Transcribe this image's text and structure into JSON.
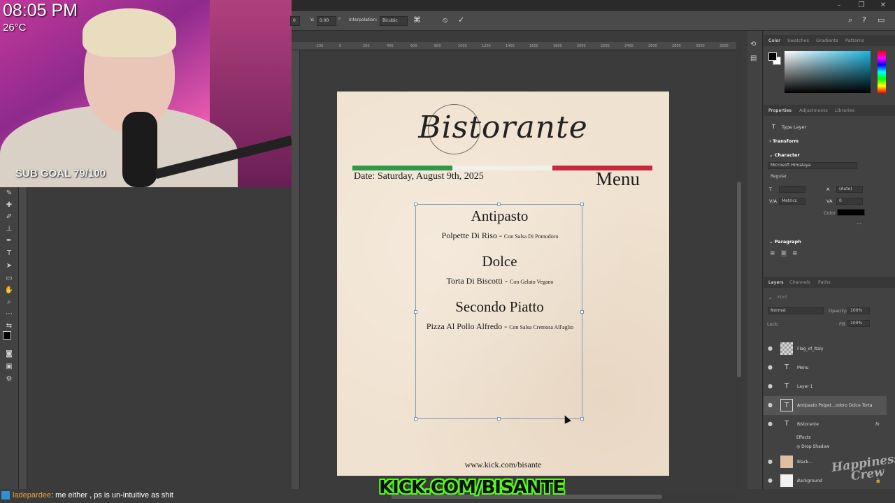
{
  "stream": {
    "clock": "08:05 PM",
    "temperature": "26°C",
    "sub_goal": "SUB GOAL 79/100",
    "kick_banner": "KICK.COM/BISANTE",
    "chat": {
      "username": "ladepardee",
      "message": ": me either , ps is un-intuitive as shit"
    },
    "watermark": "Happiness Crew"
  },
  "options_bar": {
    "v_label": "V:",
    "v_value": "0.00",
    "interpolation_label": "Interpolation:",
    "interpolation_value": "Bicubic"
  },
  "ruler_ticks": [
    "-200",
    "0",
    "200",
    "400",
    "600",
    "800",
    "1000",
    "1200",
    "1400",
    "1600",
    "1800",
    "2000",
    "2200",
    "2400",
    "2600",
    "2800",
    "3000",
    "3200"
  ],
  "document": {
    "title": "Bistorante",
    "date": "Date: Saturday, August 9th, 2025",
    "menu_label": "Menu",
    "sections": [
      {
        "heading": "Antipasto",
        "item": "Polpette Di Riso - ",
        "detail": "Con Salsa Di Pomodoro"
      },
      {
        "heading": "Dolce",
        "item": "Torta Di Biscotti - ",
        "detail": "Con Gelato Vegano"
      },
      {
        "heading": "Secondo Piatto",
        "item": "Pizza Al Pollo Alfredo - ",
        "detail": "Con Salsa Cremosa All'aglio"
      }
    ],
    "footer_url": "www.kick.com/bisante",
    "flag_colors": [
      "#2e9a46",
      "#f2f0ea",
      "#c8283c"
    ]
  },
  "color_panel": {
    "tabs": [
      "Color",
      "Swatches",
      "Gradients",
      "Patterns"
    ]
  },
  "properties_panel": {
    "tabs": [
      "Properties",
      "Adjustments",
      "Libraries"
    ],
    "layer_type": "Type Layer",
    "transform_label": "Transform",
    "character_label": "Character",
    "font_family": "Microsoft Himalaya",
    "font_style": "Regular",
    "leading": "(Auto)",
    "kerning": "Metrics",
    "tracking": "0",
    "color_label": "Color",
    "paragraph_label": "Paragraph"
  },
  "layers_panel": {
    "tabs": [
      "Layers",
      "Channels",
      "Paths"
    ],
    "search_placeholder": "Kind",
    "blend_mode": "Normal",
    "opacity_label": "Opacity:",
    "opacity_value": "100%",
    "lock_label": "Lock:",
    "fill_label": "Fill:",
    "fill_value": "100%",
    "layers": [
      {
        "name": "Flag_of_Italy",
        "thumb": "▦"
      },
      {
        "name": "Menu",
        "thumb": "T"
      },
      {
        "name": "Layer 1",
        "thumb": "T"
      },
      {
        "name": "Antipasto  Polpet...odoro Dolce Torta",
        "thumb": "T"
      },
      {
        "name": "Bistorante",
        "thumb": "T"
      }
    ],
    "effects_label": "Effects",
    "drop_shadow_label": "Drop Shadow",
    "bottom_layers": [
      "Black...",
      "Background"
    ]
  }
}
